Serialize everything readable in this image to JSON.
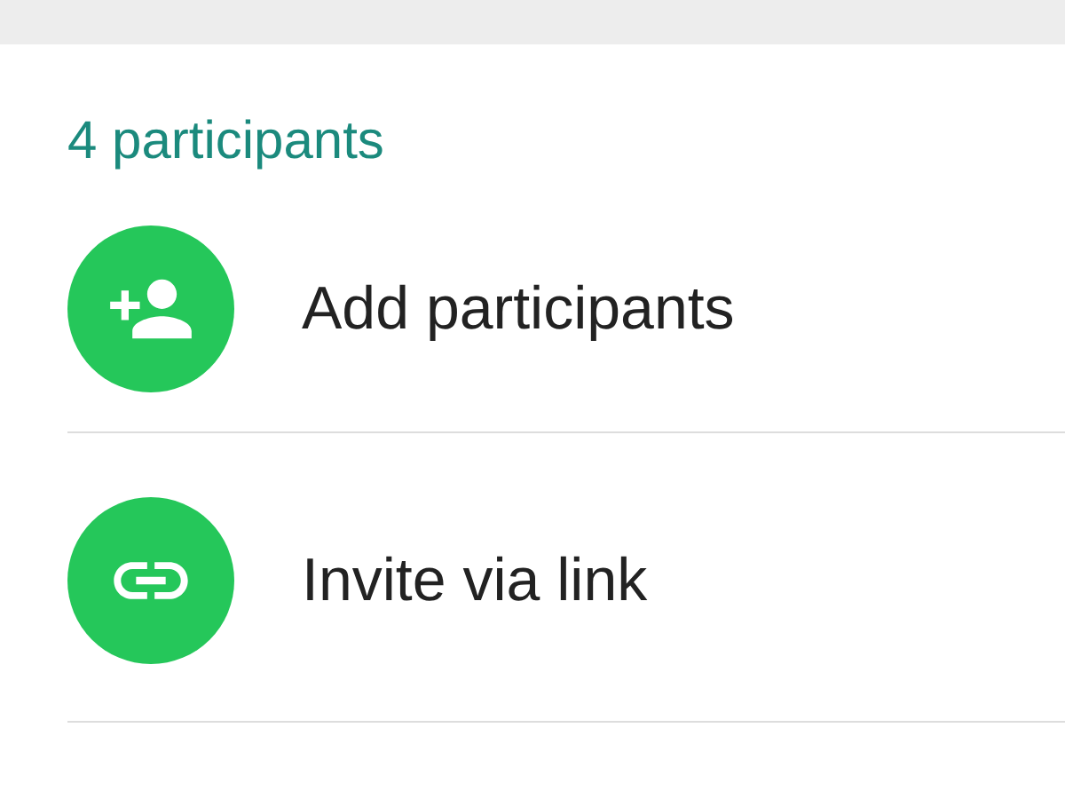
{
  "section": {
    "title": "4 participants"
  },
  "actions": [
    {
      "label": "Add participants",
      "kind": "add"
    },
    {
      "label": "Invite via link",
      "kind": "link"
    }
  ]
}
